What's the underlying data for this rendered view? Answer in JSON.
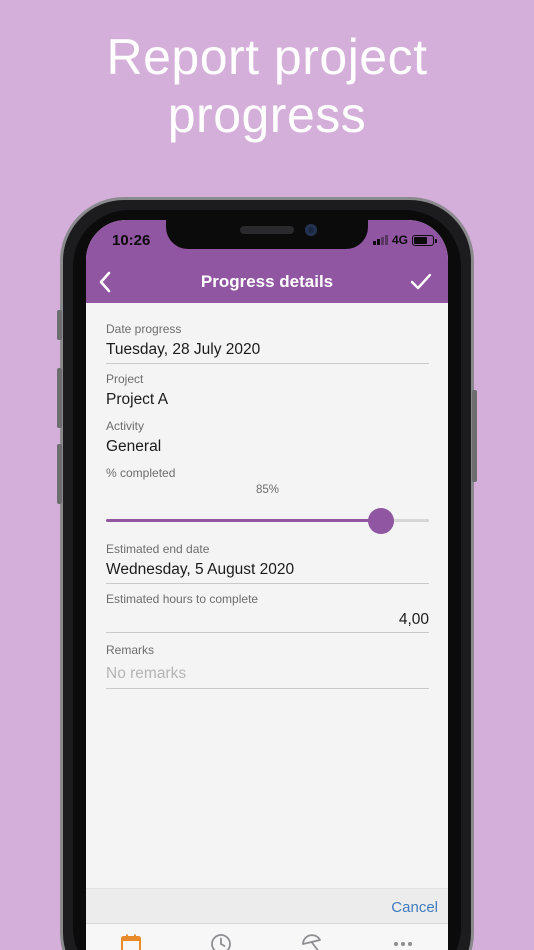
{
  "headline": {
    "line1": "Report project",
    "line2": "progress"
  },
  "status_bar": {
    "time": "10:26",
    "network": "4G"
  },
  "app_bar": {
    "title": "Progress details",
    "back_icon": "chevron-left-icon",
    "confirm_icon": "checkmark-icon"
  },
  "form": {
    "date_progress": {
      "label": "Date progress",
      "value": "Tuesday, 28 July 2020"
    },
    "project": {
      "label": "Project",
      "value": "Project A"
    },
    "activity": {
      "label": "Activity",
      "value": "General"
    },
    "percent_completed": {
      "label": "% completed",
      "value_text": "85%",
      "value": 0.85
    },
    "estimated_end_date": {
      "label": "Estimated end date",
      "value": "Wednesday, 5 August 2020"
    },
    "estimated_hours": {
      "label": "Estimated hours to complete",
      "value": "4,00"
    },
    "remarks": {
      "label": "Remarks",
      "placeholder": "No remarks"
    }
  },
  "actions": {
    "cancel_label": "Cancel"
  },
  "tab_bar": {
    "items": [
      {
        "icon": "calendar-icon",
        "active": true
      },
      {
        "icon": "clock-icon",
        "active": false
      },
      {
        "icon": "beach-umbrella-icon",
        "active": false
      },
      {
        "icon": "more-icon",
        "active": false
      }
    ]
  },
  "colors": {
    "background": "#d4afd9",
    "accent": "#9056a1",
    "link": "#3f7cbf",
    "tab_active": "#e98a2b"
  }
}
